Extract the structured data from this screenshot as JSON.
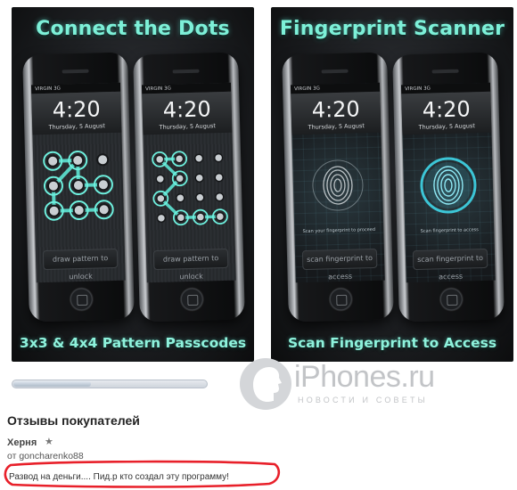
{
  "screenshots": [
    {
      "title": "Connect the Dots",
      "caption": "3x3 & 4x4 Pattern Passcodes",
      "phones": [
        {
          "carrier": "VIRGIN  3G",
          "time": "4:20",
          "date": "Thursday, 5 August",
          "unlock": "draw pattern to unlock"
        },
        {
          "carrier": "VIRGIN  3G",
          "time": "4:20",
          "date": "Thursday, 5 August",
          "unlock": "draw pattern to unlock"
        }
      ]
    },
    {
      "title": "Fingerprint Scanner",
      "caption": "Scan Fingerprint to Access",
      "phones": [
        {
          "carrier": "VIRGIN  3G",
          "time": "4:20",
          "date": "Thursday, 5 August",
          "scan_hint": "Scan your fingerprint to proceed",
          "unlock": "scan fingerprint to access"
        },
        {
          "carrier": "VIRGIN  3G",
          "time": "4:20",
          "date": "Thursday, 5 August",
          "scan_hint": "Scan fingerprint to access",
          "unlock": "scan fingerprint to access"
        }
      ]
    }
  ],
  "gallery_scroll": {
    "position": 0.4
  },
  "watermark": {
    "brand": "iPhones.ru",
    "tagline": "НОВОСТИ И СОВЕТЫ"
  },
  "reviews": {
    "section_title": "Отзывы покупателей",
    "items": [
      {
        "title": "Херня",
        "rating_symbol": "★",
        "author": "от goncharenko88",
        "text": "Развод на деньги.... Пид.р кто создал эту программу!"
      }
    ]
  },
  "colors": {
    "accent_teal": "#7df0d8",
    "highlight_red": "#e8202a",
    "watermark_grey": "#c2c4c7"
  }
}
